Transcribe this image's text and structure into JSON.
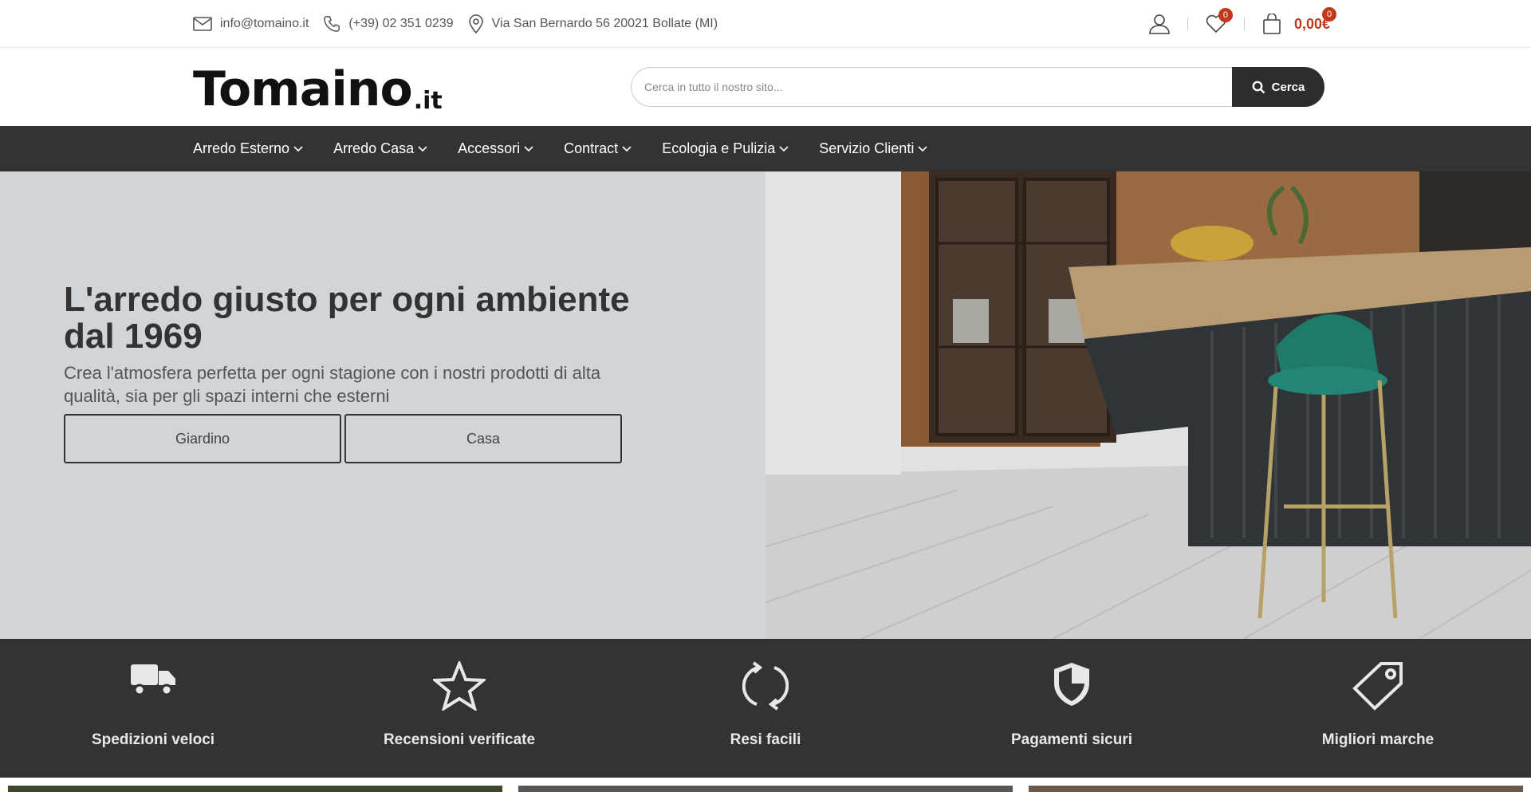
{
  "topbar": {
    "email": "info@tomaino.it",
    "phone": "(+39) 02 351 0239",
    "address": "Via San Bernardo 56 20021 Bollate (MI)",
    "wishlist_count": "0",
    "cart_count": "0",
    "cart_total": "0,00€"
  },
  "header": {
    "logo_text": "Tomaino",
    "logo_suffix": ".it",
    "search_placeholder": "Cerca in tutto il nostro sito...",
    "search_button": "Cerca"
  },
  "nav": {
    "items": [
      {
        "label": "Arredo Esterno"
      },
      {
        "label": "Arredo Casa"
      },
      {
        "label": "Accessori"
      },
      {
        "label": "Contract"
      },
      {
        "label": "Ecologia e Pulizia"
      },
      {
        "label": "Servizio Clienti"
      }
    ]
  },
  "hero": {
    "title": "L'arredo giusto per ogni ambiente dal 1969",
    "subtitle": "Crea l'atmosfera perfetta per ogni stagione con i nostri prodotti di alta qualità, sia per gli spazi interni che esterni",
    "buttons": [
      {
        "label": "Giardino"
      },
      {
        "label": "Casa"
      }
    ]
  },
  "features": [
    {
      "label": "Spedizioni veloci",
      "icon": "truck-icon"
    },
    {
      "label": "Recensioni verificate",
      "icon": "star-icon"
    },
    {
      "label": "Resi facili",
      "icon": "refresh-icon"
    },
    {
      "label": "Pagamenti sicuri",
      "icon": "shield-icon"
    },
    {
      "label": "Migliori marche",
      "icon": "tag-icon"
    }
  ],
  "colors": {
    "accent": "#c0391b",
    "nav_bg": "#333333",
    "hero_bg": "#d1d5d8"
  }
}
